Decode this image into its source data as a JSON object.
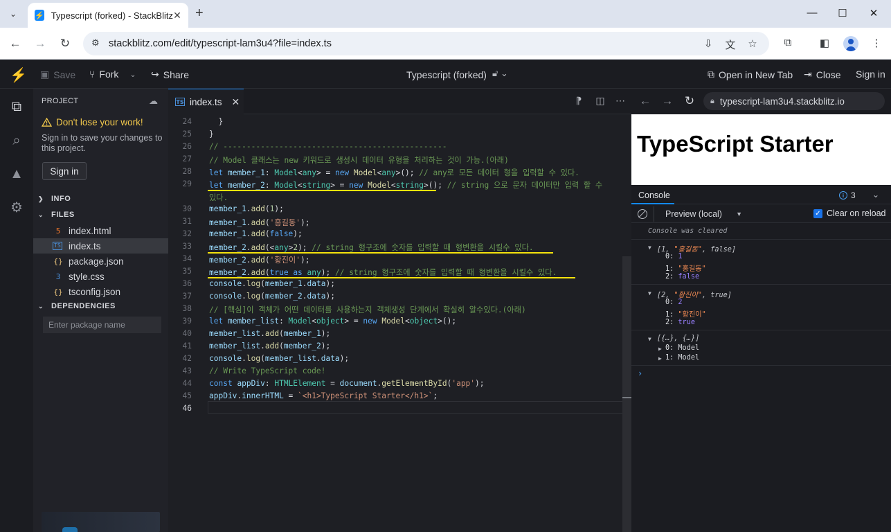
{
  "browser": {
    "tab_title": "Typescript (forked) - StackBlitz",
    "url": "stackblitz.com/edit/typescript-lam3u4?file=index.ts"
  },
  "header": {
    "save_label": "Save",
    "fork_label": "Fork",
    "share_label": "Share",
    "project_title": "Typescript (forked)",
    "open_new_tab_label": "Open in New Tab",
    "close_label": "Close",
    "sign_in_label": "Sign in"
  },
  "sidebar": {
    "title": "PROJECT",
    "warning_title": "Don't lose your work!",
    "warning_text": "Sign in to save your changes to this project.",
    "sign_in_button": "Sign in",
    "sections": {
      "info": "INFO",
      "files": "FILES",
      "dependencies": "DEPENDENCIES"
    },
    "files": [
      {
        "name": "index.html",
        "icon": "html-file-icon"
      },
      {
        "name": "index.ts",
        "icon": "ts-file-icon",
        "selected": true
      },
      {
        "name": "package.json",
        "icon": "json-file-icon"
      },
      {
        "name": "style.css",
        "icon": "css-file-icon"
      },
      {
        "name": "tsconfig.json",
        "icon": "json-file-icon"
      }
    ],
    "package_placeholder": "Enter package name"
  },
  "editor": {
    "tab_label": "index.ts",
    "tab_badge": "TS",
    "line_numbers": [
      "24",
      "25",
      "26",
      "27",
      "28",
      "29",
      "30",
      "31",
      "32",
      "33",
      "34",
      "35",
      "36",
      "37",
      "38",
      "39",
      "40",
      "41",
      "42",
      "43",
      "44",
      "45",
      "46"
    ],
    "current_line": "46"
  },
  "preview": {
    "url": "typescript-lam3u4.stackblitz.io",
    "heading": "TypeScript Starter"
  },
  "console": {
    "tab_label": "Console",
    "info_count": "3",
    "context": "Preview (local)",
    "clear_on_reload_label": "Clear on reload",
    "cleared_text": "Console was cleared",
    "groups": [
      {
        "summary_parts": [
          "[1, ",
          "\"홍길동\"",
          ", false]"
        ],
        "items": [
          {
            "key": "0",
            "value": "1",
            "kind": "num"
          },
          {
            "key": "1",
            "value": "\"홍길동\"",
            "kind": "str"
          },
          {
            "key": "2",
            "value": "false",
            "kind": "bool"
          }
        ]
      },
      {
        "summary_parts": [
          "[2, ",
          "\"황진이\"",
          ", true]"
        ],
        "items": [
          {
            "key": "0",
            "value": "2",
            "kind": "num"
          },
          {
            "key": "1",
            "value": "\"황진이\"",
            "kind": "str"
          },
          {
            "key": "2",
            "value": "true",
            "kind": "bool"
          }
        ]
      },
      {
        "summary_parts": [
          "[{…}, {…}]"
        ],
        "items": [
          {
            "key": "0",
            "value": "Model",
            "kind": "obj"
          },
          {
            "key": "1",
            "value": "Model",
            "kind": "obj"
          }
        ]
      }
    ],
    "prompt": "›"
  },
  "colors": {
    "accent": "#1389fd",
    "warning": "#f2c94c",
    "highlight_underline": "#f5e30c"
  }
}
